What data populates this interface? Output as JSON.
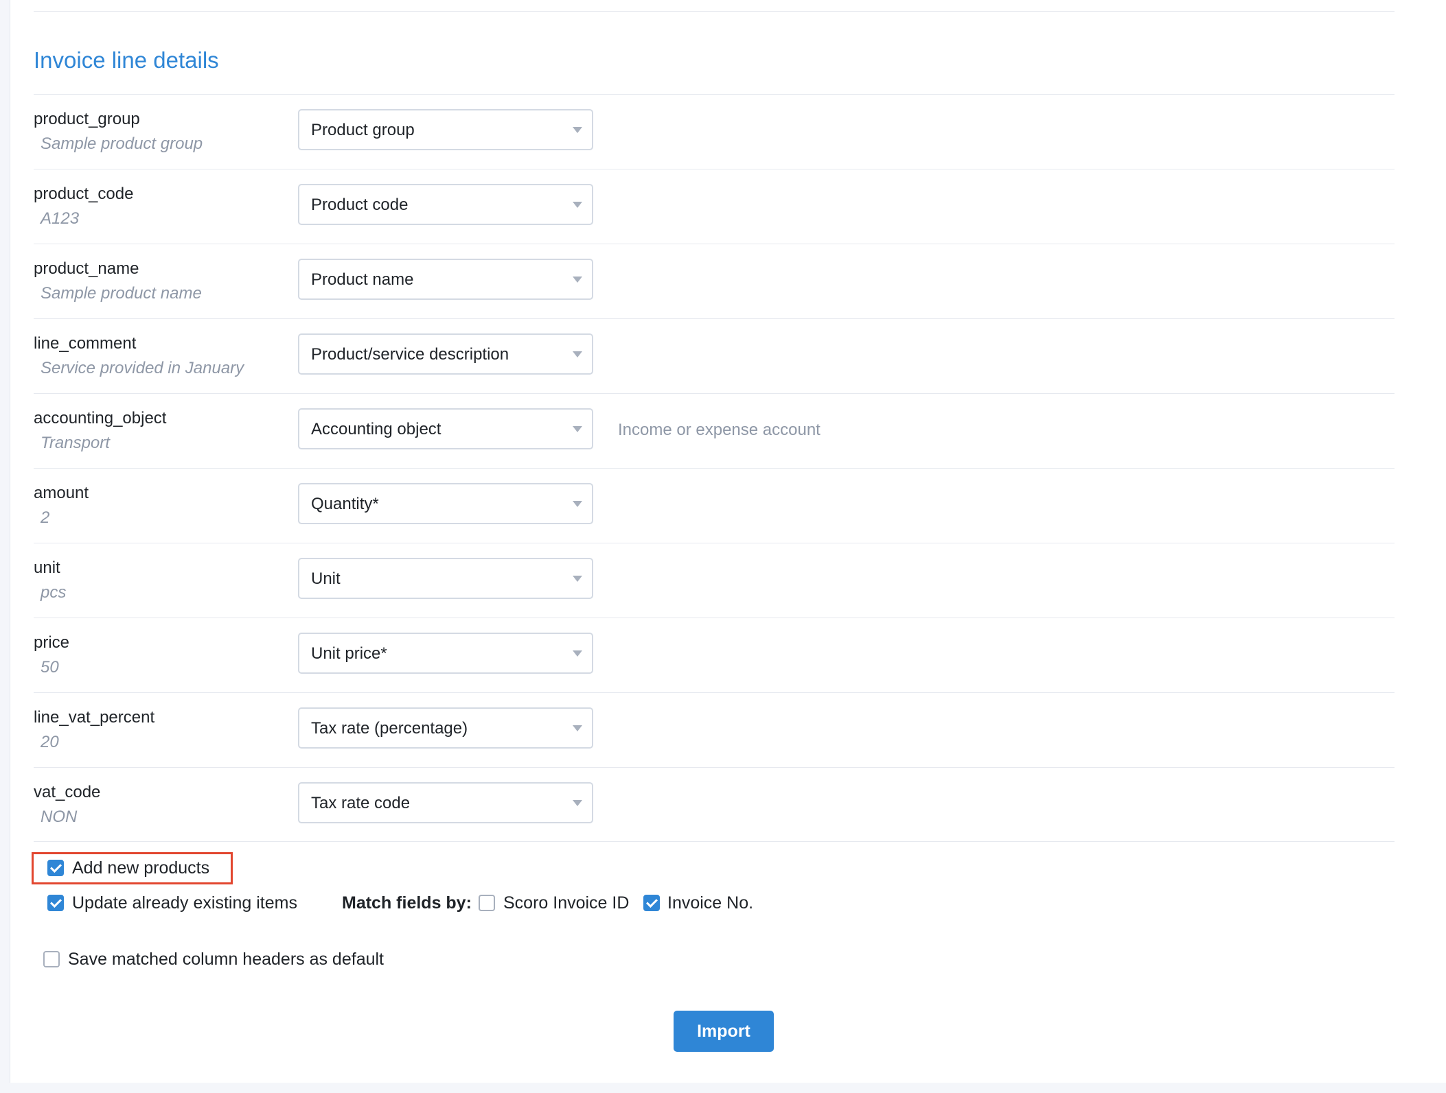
{
  "section": {
    "title": "Invoice line details"
  },
  "fields": [
    {
      "name": "product_group",
      "sample": "Sample product group",
      "mapping": "Product group",
      "hint": ""
    },
    {
      "name": "product_code",
      "sample": "A123",
      "mapping": "Product code",
      "hint": ""
    },
    {
      "name": "product_name",
      "sample": "Sample product name",
      "mapping": "Product name",
      "hint": ""
    },
    {
      "name": "line_comment",
      "sample": "Service provided in January",
      "mapping": "Product/service description",
      "hint": ""
    },
    {
      "name": "accounting_object",
      "sample": "Transport",
      "mapping": "Accounting object",
      "hint": "Income or expense account"
    },
    {
      "name": "amount",
      "sample": "2",
      "mapping": "Quantity*",
      "hint": ""
    },
    {
      "name": "unit",
      "sample": "pcs",
      "mapping": "Unit",
      "hint": ""
    },
    {
      "name": "price",
      "sample": "50",
      "mapping": "Unit price*",
      "hint": ""
    },
    {
      "name": "line_vat_percent",
      "sample": "20",
      "mapping": "Tax rate (percentage)",
      "hint": ""
    },
    {
      "name": "vat_code",
      "sample": "NON",
      "mapping": "Tax rate code",
      "hint": ""
    }
  ],
  "options": {
    "add_new_products": {
      "label": "Add new products",
      "checked": true
    },
    "update_existing": {
      "label": "Update already existing items",
      "checked": true
    },
    "match_fields_label": "Match fields by:",
    "match_scoro_invoice_id": {
      "label": "Scoro Invoice ID",
      "checked": false
    },
    "match_invoice_no": {
      "label": "Invoice No.",
      "checked": true
    },
    "save_headers_default": {
      "label": "Save matched column headers as default",
      "checked": false
    }
  },
  "actions": {
    "import_label": "Import"
  },
  "colors": {
    "accent": "#2f86d6",
    "highlight_border": "#e2462f",
    "muted_text": "#8e97a6"
  }
}
